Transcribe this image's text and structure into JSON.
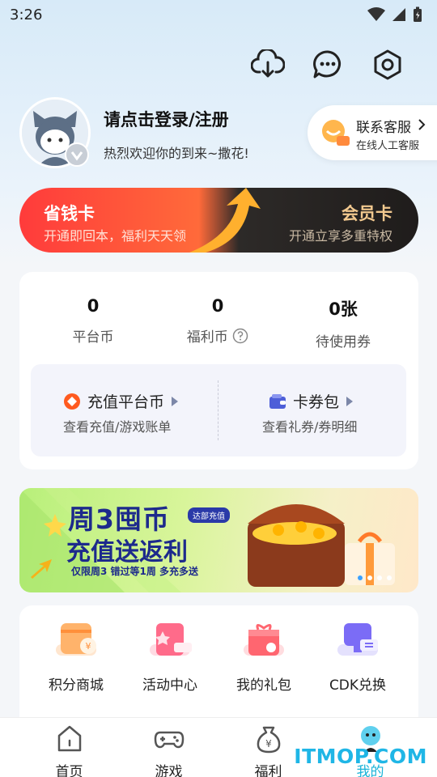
{
  "status_bar": {
    "time": "3:26"
  },
  "profile": {
    "login_prompt": "请点击登录/注册",
    "welcome": "热烈欢迎你的到来~撒花!"
  },
  "customer_service": {
    "title": "联系客服",
    "subtitle": "在线人工客服"
  },
  "cards": {
    "saving": {
      "title": "省钱卡",
      "subtitle": "开通即回本，福利天天领"
    },
    "member": {
      "title": "会员卡",
      "subtitle": "开通立享多重特权"
    }
  },
  "stats": [
    {
      "value": "0",
      "label": "平台币"
    },
    {
      "value": "0",
      "label": "福利币"
    },
    {
      "value": "0张",
      "label": "待使用券"
    }
  ],
  "wallet": {
    "recharge": {
      "title": "充值平台币",
      "desc": "查看充值/游戏账单"
    },
    "coupons": {
      "title": "卡券包",
      "desc": "查看礼券/券明细"
    }
  },
  "promo": {
    "line1": "周3囤币",
    "line2": "充值送返利",
    "tag": "达部充值",
    "line3": "仅限周3  错过等1周  多充多送"
  },
  "services": [
    {
      "label": "积分商城",
      "icon": "shop-icon",
      "color": "#ffb36b"
    },
    {
      "label": "活动中心",
      "icon": "activity-icon",
      "color": "#ff6b8a"
    },
    {
      "label": "我的礼包",
      "icon": "gift-icon",
      "color": "#ff6670"
    },
    {
      "label": "CDK兑换",
      "icon": "cdk-icon",
      "color": "#7b6cf6"
    }
  ],
  "tabs": [
    {
      "label": "首页",
      "icon": "home-icon"
    },
    {
      "label": "游戏",
      "icon": "gamepad-icon"
    },
    {
      "label": "福利",
      "icon": "money-bag-icon"
    },
    {
      "label": "我的",
      "icon": "profile-icon",
      "active": true
    }
  ],
  "watermark": "ITMOP.COM"
}
